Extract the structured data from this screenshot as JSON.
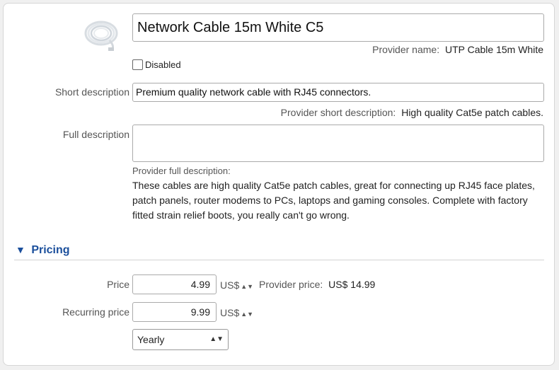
{
  "product": {
    "name_value": "Network Cable 15m White C5",
    "provider_name_label": "Provider name:",
    "provider_name_value": "UTP Cable 15m White",
    "disabled_label": "Disabled",
    "disabled_checked": false
  },
  "short_description": {
    "label": "Short description",
    "value": "Premium quality network cable with RJ45 connectors.",
    "provider_label": "Provider short description:",
    "provider_value": "High quality Cat5e patch cables."
  },
  "full_description": {
    "label": "Full description",
    "value": "",
    "provider_label": "Provider full description:",
    "provider_value": "These cables are high quality Cat5e patch cables, great for connecting up RJ45 face plates, patch panels, router modems to PCs, laptops and gaming consoles. Complete with factory fitted strain relief boots, you really can't go wrong."
  },
  "pricing": {
    "section_title": "Pricing",
    "toggle_icon": "triangle-down-icon",
    "price_label": "Price",
    "price_value": "4.99",
    "currency": "US$",
    "provider_price_label": "Provider price:",
    "provider_price_value": "US$ 14.99",
    "recurring_label": "Recurring price",
    "recurring_value": "9.99",
    "recurring_currency": "US$",
    "period_selected": "Yearly"
  },
  "icons": {
    "product_image": "cable-coil-image",
    "stepper": "up-down-arrows-icon",
    "select_caret": "up-down-caret-icon"
  },
  "colors": {
    "accent": "#1b4f9c",
    "border": "#aaaaaa",
    "card_background": "#ffffff",
    "page_background": "#f0f0f0"
  }
}
